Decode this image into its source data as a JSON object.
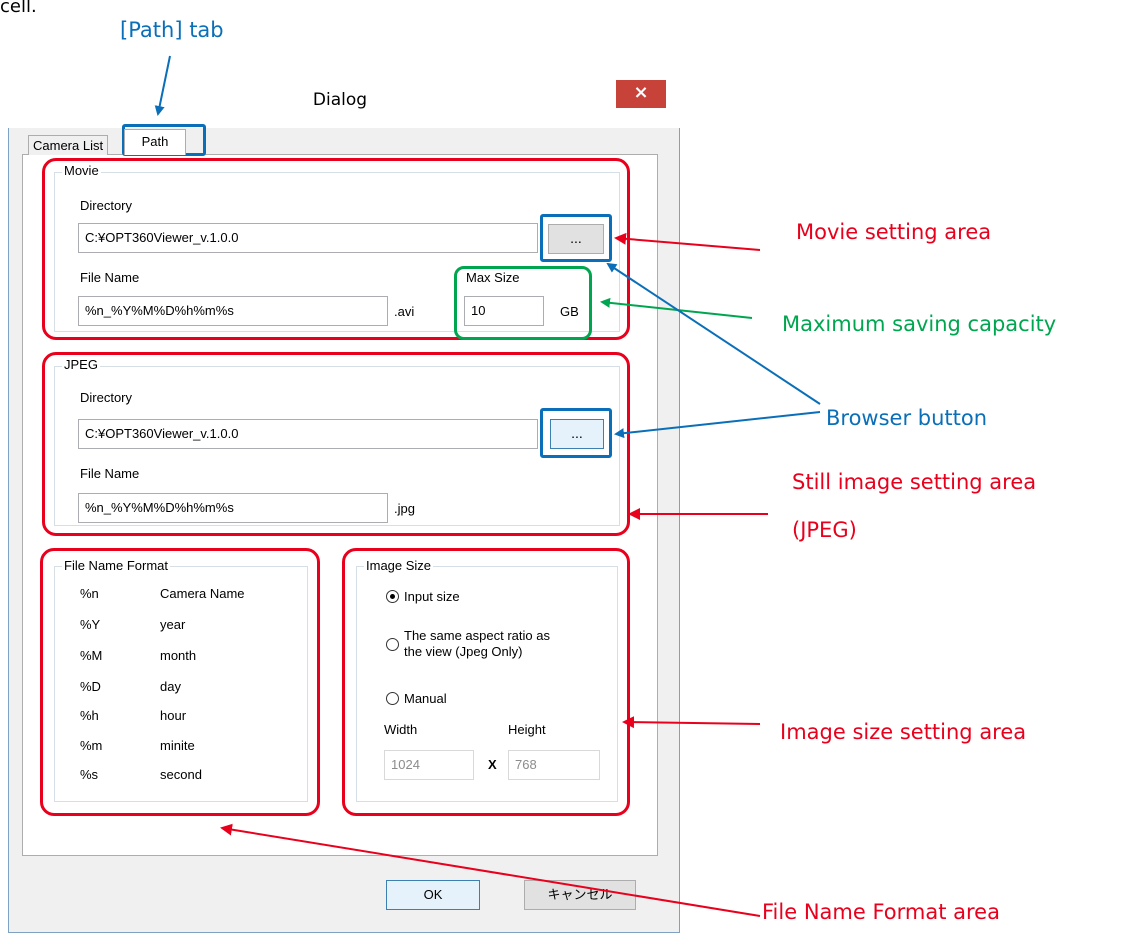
{
  "caption_fragment": "cell.",
  "dialog": {
    "title": "Dialog",
    "close_glyph": "×",
    "tabs": [
      "Camera List",
      "Path"
    ],
    "movie": {
      "group_label": "Movie",
      "directory_label": "Directory",
      "directory_value": "C:¥OPT360Viewer_v.1.0.0",
      "browse_label": "...",
      "filename_label": "File Name",
      "filename_value": "%n_%Y%M%D%h%m%s",
      "extension": ".avi",
      "max_size_label": "Max Size",
      "max_size_value": "10",
      "max_size_unit": "GB"
    },
    "jpeg": {
      "group_label": "JPEG",
      "directory_label": "Directory",
      "directory_value": "C:¥OPT360Viewer_v.1.0.0",
      "browse_label": "...",
      "filename_label": "File Name",
      "filename_value": "%n_%Y%M%D%h%m%s",
      "extension": ".jpg"
    },
    "filename_format": {
      "group_label": "File Name Format",
      "rows": [
        {
          "code": "%n",
          "meaning": "Camera Name"
        },
        {
          "code": "%Y",
          "meaning": "year"
        },
        {
          "code": "%M",
          "meaning": "month"
        },
        {
          "code": "%D",
          "meaning": "day"
        },
        {
          "code": "%h",
          "meaning": "hour"
        },
        {
          "code": "%m",
          "meaning": "minite"
        },
        {
          "code": "%s",
          "meaning": "second"
        }
      ]
    },
    "image_size": {
      "group_label": "Image Size",
      "option_input": "Input size",
      "option_aspect_line1": "The same aspect ratio as",
      "option_aspect_line2": "the view (Jpeg Only)",
      "option_manual": "Manual",
      "selected": "Input size",
      "width_label": "Width",
      "height_label": "Height",
      "width_value": "1024",
      "separator": "X",
      "height_value": "768"
    },
    "ok_label": "OK",
    "cancel_label": "キャンセル"
  },
  "annotations": {
    "path_tab": "[Path] tab",
    "movie_area": "Movie setting area",
    "max_capacity": "Maximum saving capacity",
    "browser_button": "Browser button",
    "still_line1": "Still image setting area",
    "still_line2": "(JPEG)",
    "image_size_area": "Image size setting area",
    "file_name_format_area": "File Name Format area"
  },
  "colors": {
    "annotation_red": "#e8001c",
    "annotation_blue": "#0a6fb8",
    "annotation_green": "#00a64f",
    "close_button": "#c7433a"
  }
}
